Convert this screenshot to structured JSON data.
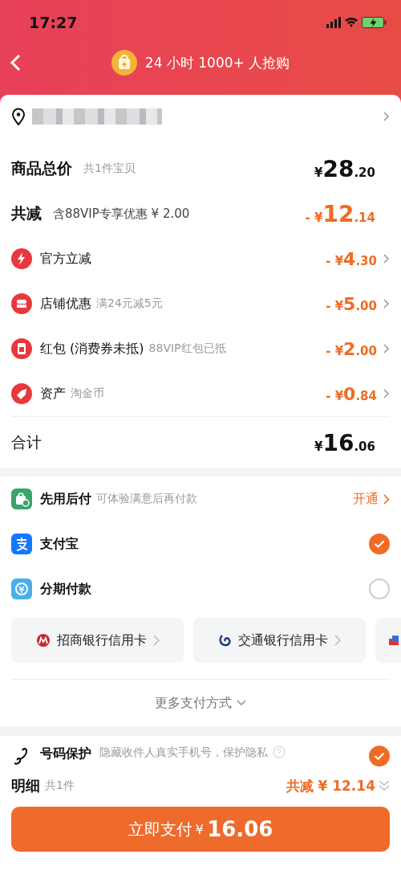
{
  "status_bar": {
    "time": "17:27"
  },
  "header": {
    "title": "24 小时 1000+ 人抢购"
  },
  "summary": {
    "total": {
      "label": "商品总价",
      "note": "共1件宝贝",
      "yen": "¥",
      "int": "28",
      "dec": ".20"
    },
    "discount": {
      "label": "共减",
      "note": "含88VIP专享优惠 ¥ 2.00",
      "sign": "-",
      "yen": "¥",
      "int": "12",
      "dec": ".14"
    },
    "items": [
      {
        "kind": "bolt",
        "label": "官方立减",
        "sign": "-",
        "yen": "¥",
        "int": "4",
        "dec": ".30"
      },
      {
        "kind": "shop",
        "label": "店铺优惠",
        "note": "满24元减5元",
        "sign": "-",
        "yen": "¥",
        "int": "5",
        "dec": ".00"
      },
      {
        "kind": "envelope",
        "label": "红包 (消费券未抵)",
        "note": "88VIP红包已抵",
        "sign": "-",
        "yen": "¥",
        "int": "2",
        "dec": ".00"
      },
      {
        "kind": "tag",
        "label": "资产",
        "note": "淘金币",
        "sign": "-",
        "yen": "¥",
        "int": "0",
        "dec": ".84"
      }
    ],
    "sum": {
      "label": "合计",
      "yen": "¥",
      "int": "16",
      "dec": ".06"
    }
  },
  "payment": {
    "methods": [
      {
        "kind": "later",
        "label": "先用后付",
        "note": "可体验满意后再付款",
        "action": "开通"
      },
      {
        "kind": "alipay",
        "label": "支付宝",
        "selected": true
      },
      {
        "kind": "installment",
        "label": "分期付款",
        "selected": false
      }
    ],
    "cards": [
      {
        "kind": "cmb",
        "label": "招商银行信用卡"
      },
      {
        "kind": "bocom",
        "label": "交通银行信用卡"
      },
      {
        "kind": "other"
      }
    ],
    "more": "更多支付方式"
  },
  "protection": {
    "label": "号码保护",
    "note": "隐藏收件人真实手机号，保护隐私",
    "checked": true
  },
  "footer": {
    "label": "明细",
    "count": "共1件",
    "discount": "共减 ¥ 12.14",
    "button": {
      "label": "立即支付",
      "yen": "¥",
      "amount": "16.06"
    }
  }
}
